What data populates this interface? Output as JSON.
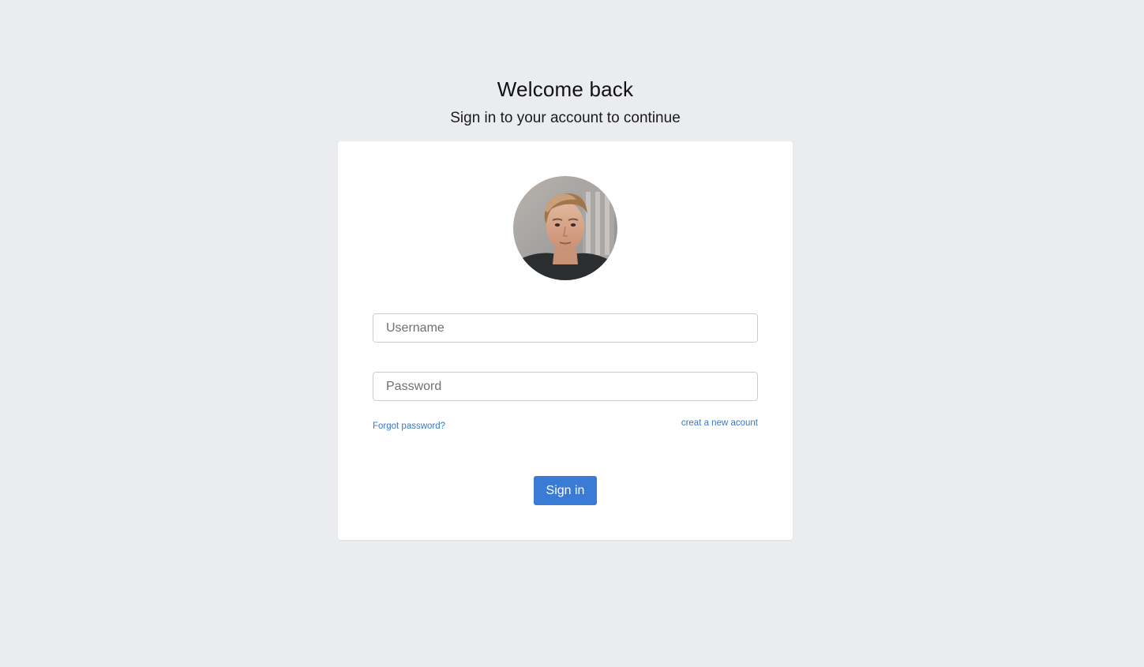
{
  "header": {
    "title": "Welcome back",
    "subtitle": "Sign in to your account to continue"
  },
  "form": {
    "avatar_icon": "user-avatar-photo",
    "username": {
      "placeholder": "Username",
      "value": ""
    },
    "password": {
      "placeholder": "Password",
      "value": ""
    },
    "forgot_link": "Forgot password?",
    "create_link": "creat a new acount",
    "submit_label": "Sign in"
  },
  "colors": {
    "background": "#eaecef",
    "card": "#ffffff",
    "accent": "#3a7bd5",
    "link": "#3b78c4"
  }
}
